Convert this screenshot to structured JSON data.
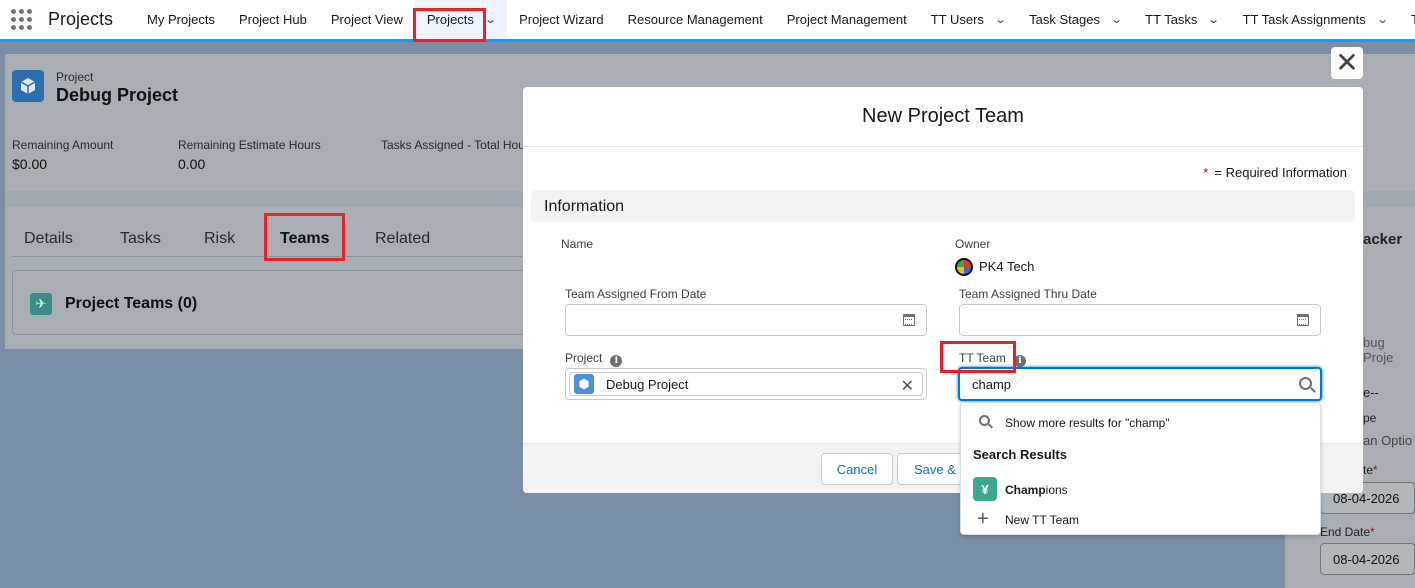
{
  "nav": {
    "app_name": "Projects",
    "items": [
      {
        "label": "My Projects",
        "chevron": false
      },
      {
        "label": "Project Hub",
        "chevron": false
      },
      {
        "label": "Project View",
        "chevron": false
      },
      {
        "label": "Projects",
        "chevron": true,
        "active": true
      },
      {
        "label": "Project Wizard",
        "chevron": false
      },
      {
        "label": "Resource Management",
        "chevron": false
      },
      {
        "label": "Project Management",
        "chevron": false
      },
      {
        "label": "TT Users",
        "chevron": true
      },
      {
        "label": "Task Stages",
        "chevron": true
      },
      {
        "label": "TT Tasks",
        "chevron": true
      },
      {
        "label": "TT Task Assignments",
        "chevron": true
      },
      {
        "label": "T",
        "chevron": false
      }
    ]
  },
  "record": {
    "object_type": "Project",
    "title": "Debug Project",
    "fields": [
      {
        "label": "Remaining Amount",
        "value": "$0.00"
      },
      {
        "label": "Remaining Estimate Hours",
        "value": "0.00"
      },
      {
        "label": "Tasks Assigned - Total Hou",
        "value": ""
      }
    ],
    "tabs": [
      "Details",
      "Tasks",
      "Risk",
      "Teams",
      "Related"
    ],
    "selected_tab": "Teams",
    "card_title": "Project Teams (0)"
  },
  "right_panel": {
    "title": "acker",
    "lines": [
      "bug Proje",
      "e--",
      "pe",
      "an Optio",
      "te",
      "End Date"
    ],
    "start_date": "08-04-2026",
    "end_date": "08-04-2026"
  },
  "modal": {
    "title": "New Project Team",
    "required_info": "= Required Information",
    "section": "Information",
    "name_label": "Name",
    "owner_label": "Owner",
    "owner_value": "PK4 Tech",
    "from_date_label": "Team Assigned From Date",
    "thru_date_label": "Team Assigned Thru Date",
    "from_date_value": "",
    "thru_date_value": "",
    "project_label": "Project",
    "project_value": "Debug Project",
    "tt_team_label": "TT Team",
    "tt_team_value": "champ",
    "cancel": "Cancel",
    "save_new": "Save &"
  },
  "dropdown": {
    "show_more": "Show more results for \"champ\"",
    "heading": "Search Results",
    "result_match": "Champ",
    "result_rest": "ions",
    "new_item": "New TT Team"
  },
  "colors": {
    "highlight": "#e8202a",
    "brand_blue": "#0176d3",
    "team_icon": "#3ba88f"
  }
}
